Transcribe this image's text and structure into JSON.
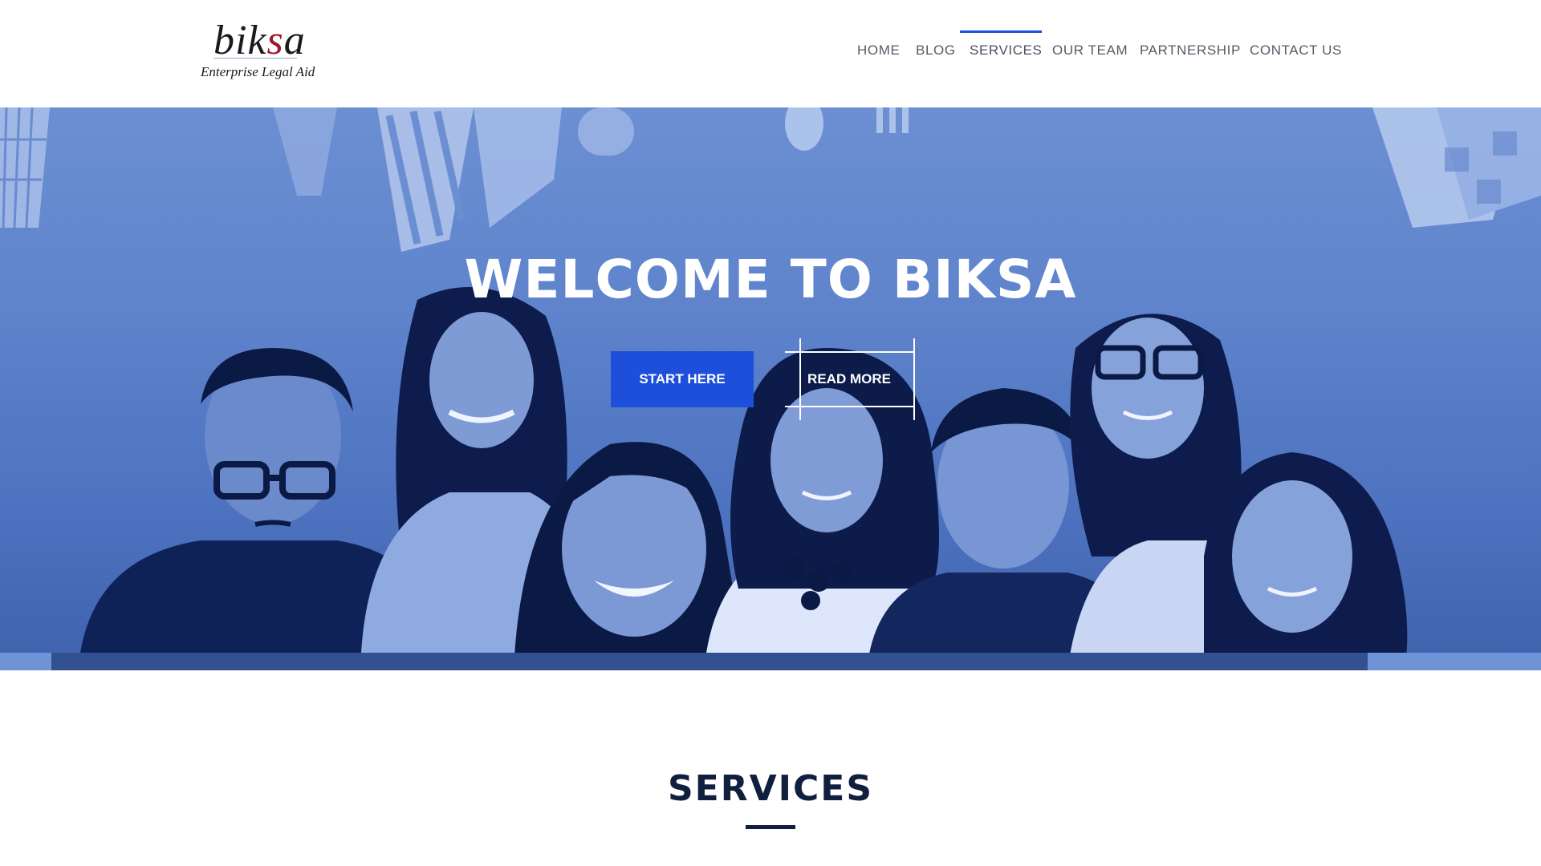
{
  "brand": {
    "logo_word_pre": "bik",
    "logo_word_accent": "s",
    "logo_word_post": "a",
    "tagline": "Enterprise Legal Aid",
    "accent_color": "#9b1b2a"
  },
  "nav": {
    "items": [
      {
        "label": "HOME"
      },
      {
        "label": "BLOG"
      },
      {
        "label": "SERVICES",
        "active": true
      },
      {
        "label": "OUR TEAM"
      },
      {
        "label": "PARTNERSHIP"
      },
      {
        "label": "CONTACT US"
      }
    ],
    "active_color": "#1d4fdb"
  },
  "hero": {
    "title": "WELCOME TO BIKSA",
    "primary_button": "START HERE",
    "secondary_button": "READ MORE",
    "overlay_color": "#4f75c2",
    "button_color": "#1d4fdb"
  },
  "services": {
    "heading": "SERVICES",
    "heading_color": "#0f1f3d"
  }
}
